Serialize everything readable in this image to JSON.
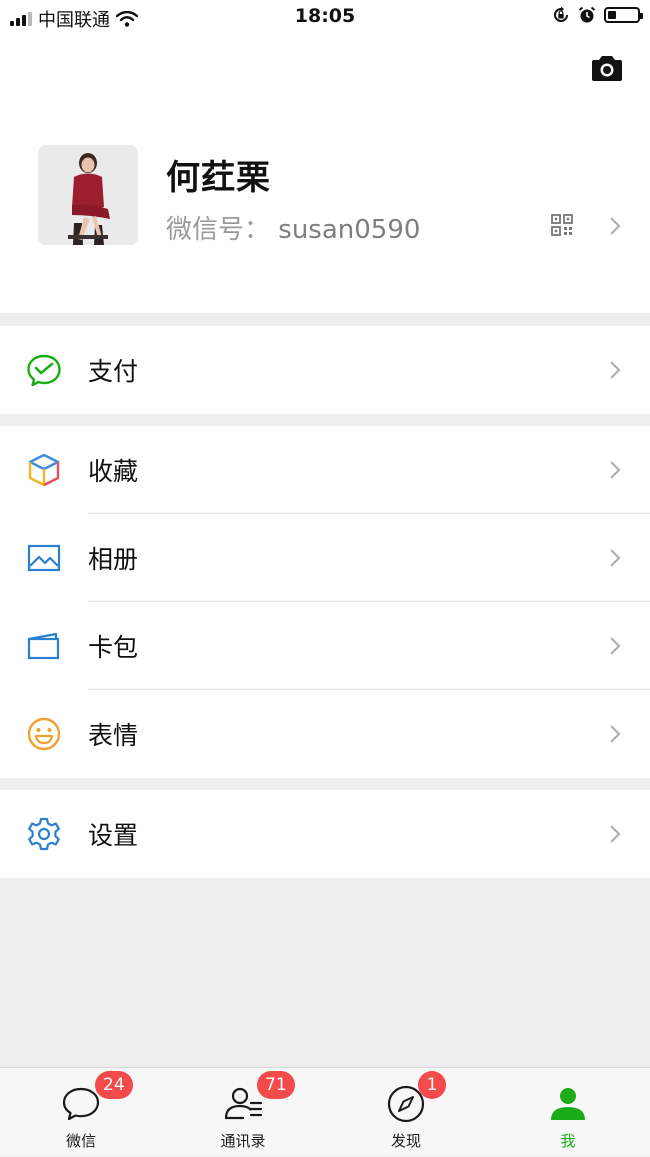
{
  "status_bar": {
    "carrier": "中国联通",
    "time": "18:05",
    "battery_level": 0.3
  },
  "profile": {
    "name": "何荭栗",
    "wechat_id_label": "微信号：",
    "wechat_id": "susan0590",
    "camera_icon": "camera-icon",
    "qr_icon": "qr-code-icon"
  },
  "menu": {
    "pay": {
      "label": "支付",
      "icon": "wechat-pay-icon",
      "color": "#1aad19"
    },
    "favorites": {
      "label": "收藏",
      "icon": "favorites-cube-icon"
    },
    "album": {
      "label": "相册",
      "icon": "album-icon",
      "color": "#2b7fd0"
    },
    "cards": {
      "label": "卡包",
      "icon": "wallet-icon",
      "color": "#2b7fd0"
    },
    "stickers": {
      "label": "表情",
      "icon": "smiley-icon",
      "color": "#f0a031"
    },
    "settings": {
      "label": "设置",
      "icon": "gear-icon",
      "color": "#2b7fd0"
    }
  },
  "tabbar": {
    "chats": {
      "label": "微信",
      "badge": "24"
    },
    "contacts": {
      "label": "通讯录",
      "badge": "71"
    },
    "discover": {
      "label": "发现",
      "badge": "1"
    },
    "me": {
      "label": "我"
    },
    "active_color": "#1aad19",
    "badge_color": "#f34a4a"
  }
}
